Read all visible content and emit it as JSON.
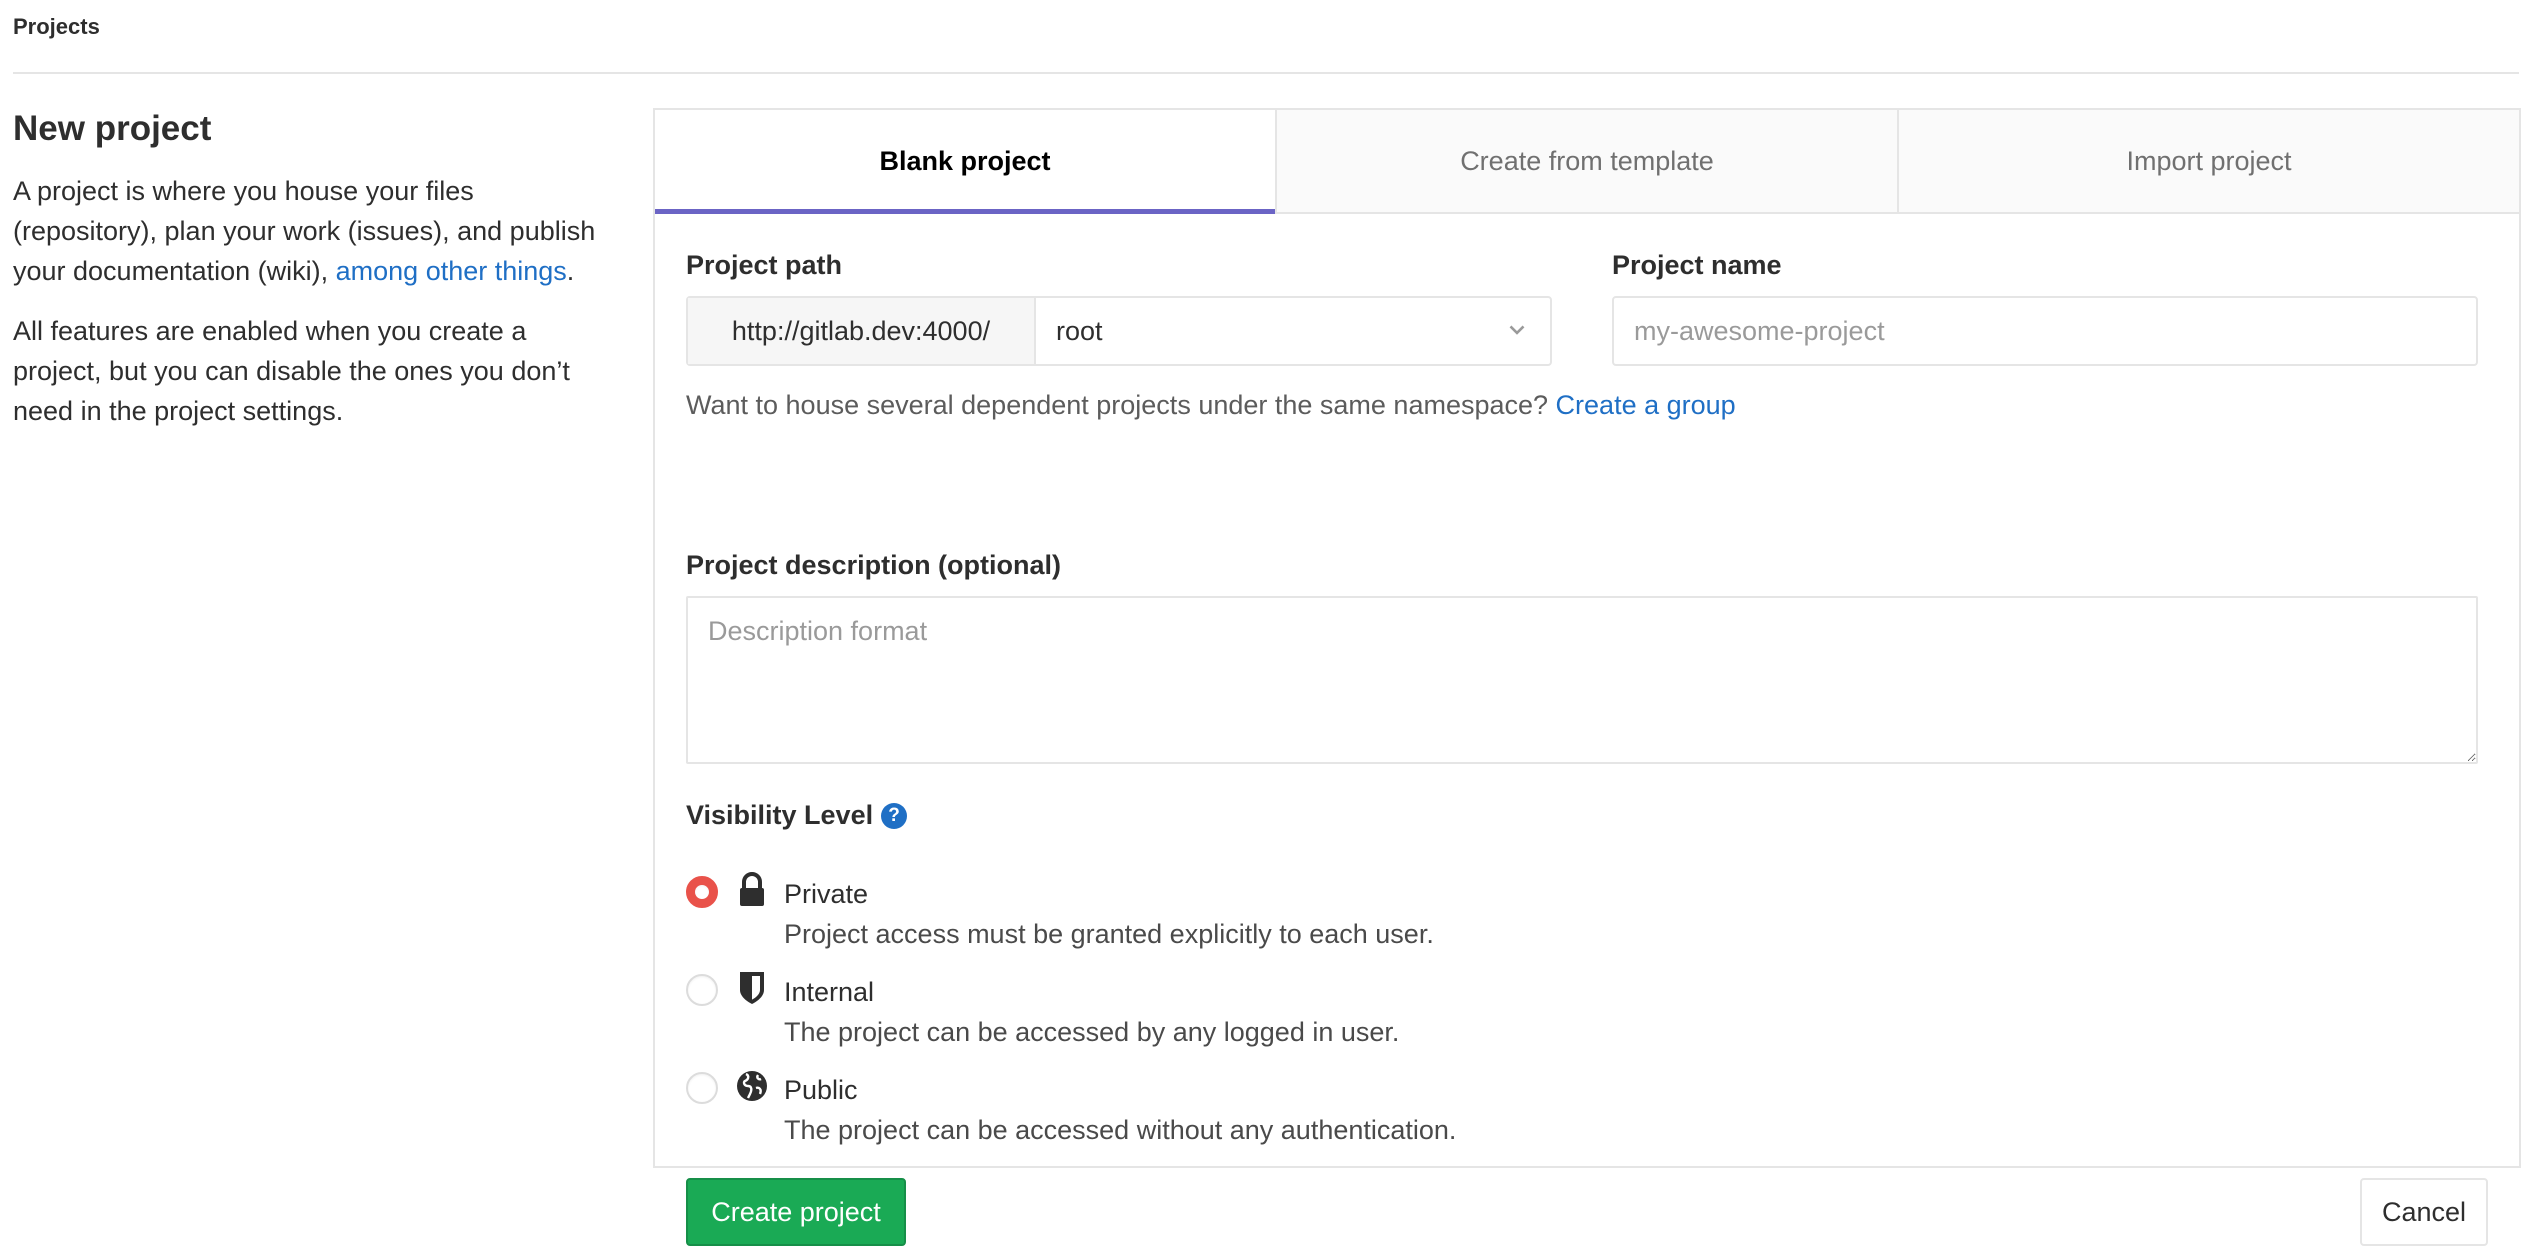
{
  "breadcrumb": "Projects",
  "left": {
    "title": "New project",
    "intro_text": "A project is where you house your files (repository), plan your work (issues), and publish your documentation (wiki), ",
    "intro_link": "among other things",
    "intro_end": ".",
    "features_text": "All features are enabled when you create a project, but you can disable the ones you don’t need in the project settings."
  },
  "tabs": [
    {
      "label": "Blank project",
      "active": true
    },
    {
      "label": "Create from template",
      "active": false
    },
    {
      "label": "Import project",
      "active": false
    }
  ],
  "form": {
    "path_label": "Project path",
    "path_prefix": "http://gitlab.dev:4000/",
    "namespace_value": "root",
    "name_label": "Project name",
    "name_placeholder": "my-awesome-project",
    "name_value": "",
    "group_help_text": "Want to house several dependent projects under the same namespace? ",
    "group_help_link": "Create a group",
    "description_label": "Project description (optional)",
    "description_placeholder": "Description format",
    "description_value": "",
    "visibility_label": "Visibility Level",
    "visibility_help_icon": "question-circle-icon",
    "visibility_options": [
      {
        "title": "Private",
        "description": "Project access must be granted explicitly to each user.",
        "icon": "lock-icon",
        "checked": true
      },
      {
        "title": "Internal",
        "description": "The project can be accessed by any logged in user.",
        "icon": "shield-icon",
        "checked": false
      },
      {
        "title": "Public",
        "description": "The project can be accessed without any authentication.",
        "icon": "globe-icon",
        "checked": false
      }
    ],
    "create_button": "Create project",
    "cancel_button": "Cancel"
  },
  "colors": {
    "active_tab_underline": "#6b64c5",
    "link": "#1f6fc5",
    "create_button": "#1aaa55",
    "radio_checked": "#e9524a"
  }
}
